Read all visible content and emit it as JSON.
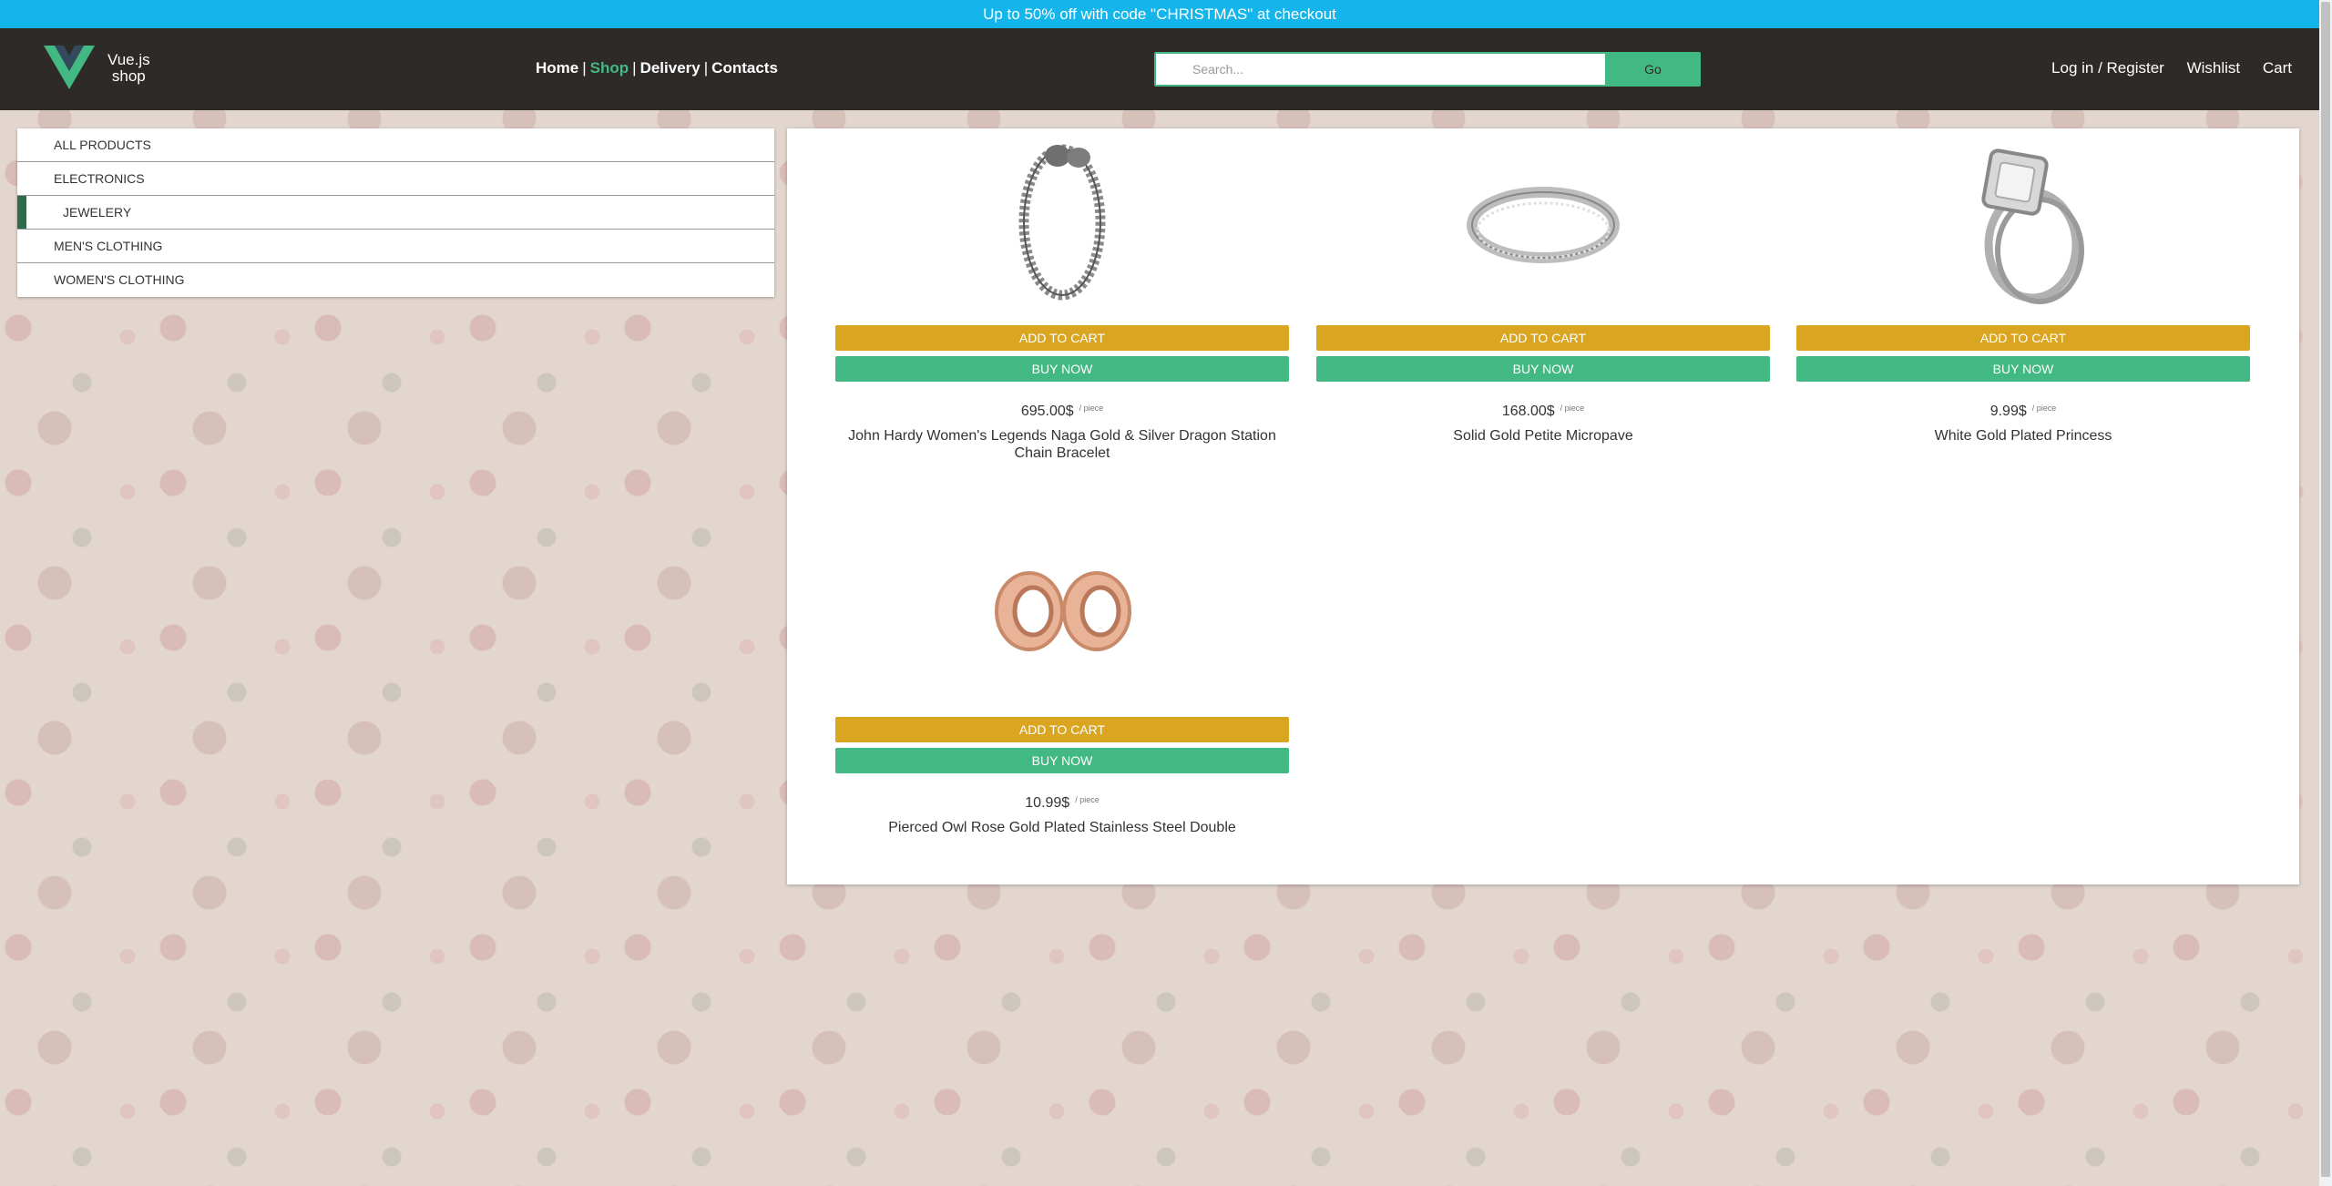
{
  "promo": {
    "text": "Up to 50% off with code \"CHRISTMAS\" at checkout"
  },
  "header": {
    "brand_line1": "Vue.js",
    "brand_line2": "shop",
    "nav": {
      "home": "Home",
      "shop": "Shop",
      "delivery": "Delivery",
      "contacts": "Contacts",
      "separator": "|"
    },
    "search": {
      "placeholder": "Search...",
      "go_label": "Go"
    },
    "login": "Log in / Register",
    "wishlist": "Wishlist",
    "cart": "Cart"
  },
  "categories": [
    {
      "label": "ALL PRODUCTS",
      "active": false
    },
    {
      "label": "ELECTRONICS",
      "active": false
    },
    {
      "label": "JEWELERY",
      "active": true
    },
    {
      "label": "MEN'S CLOTHING",
      "active": false
    },
    {
      "label": "WOMEN'S CLOTHING",
      "active": false
    }
  ],
  "products": [
    {
      "name": "John Hardy Women's Legends Naga Gold & Silver Dragon Station Chain Bracelet",
      "price": "695.00$",
      "unit": "/ piece",
      "image": "bracelet-image",
      "add_label": "ADD TO CART",
      "buy_label": "BUY NOW"
    },
    {
      "name": "Solid Gold Petite Micropave",
      "price": "168.00$",
      "unit": "/ piece",
      "image": "ring-image",
      "add_label": "ADD TO CART",
      "buy_label": "BUY NOW"
    },
    {
      "name": "White Gold Plated Princess",
      "price": "9.99$",
      "unit": "/ piece",
      "image": "engagement-ring-image",
      "add_label": "ADD TO CART",
      "buy_label": "BUY NOW"
    },
    {
      "name": "Pierced Owl Rose Gold Plated Stainless Steel Double",
      "price": "10.99$",
      "unit": "/ piece",
      "image": "ear-tunnels-image",
      "add_label": "ADD TO CART",
      "buy_label": "BUY NOW"
    }
  ],
  "colors": {
    "promo": "#13b5ea",
    "header": "#2e2a28",
    "accent": "#42b883",
    "add_to_cart": "#daa520",
    "active_category": "#2f6b4a"
  }
}
